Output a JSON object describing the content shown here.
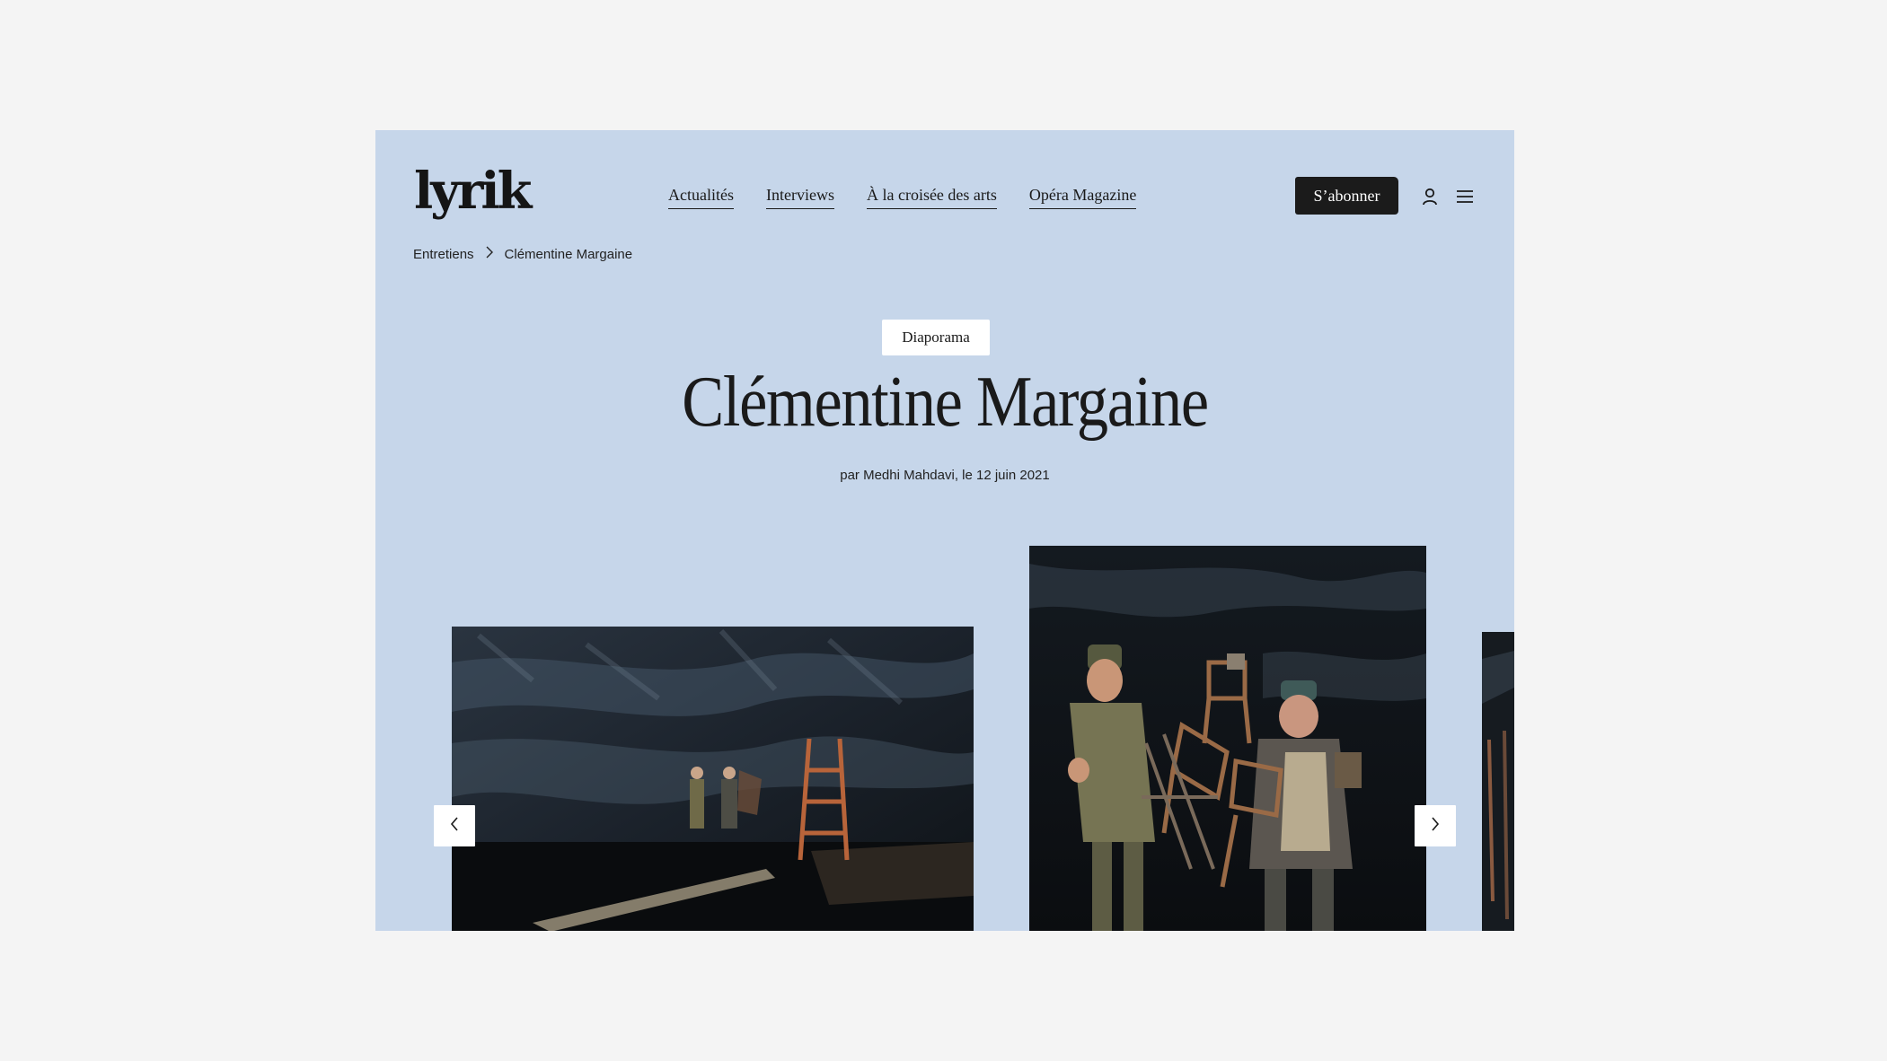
{
  "header": {
    "logo": "lyrik",
    "nav": [
      {
        "label": "Actualités"
      },
      {
        "label": "Interviews"
      },
      {
        "label": "À la croisée des arts"
      },
      {
        "label": "Opéra Magazine"
      }
    ],
    "subscribe_label": "S’abonner",
    "icons": {
      "user": "user-icon",
      "menu": "menu-icon"
    }
  },
  "breadcrumb": {
    "items": [
      "Entretiens",
      "Clémentine Margaine"
    ],
    "separator_icon": "chevron-right-icon"
  },
  "article": {
    "tag": "Diaporama",
    "title": "Clémentine Margaine",
    "byline": "par Medhi Mahdavi, le 12 juin 2021"
  },
  "carousel": {
    "prev_icon": "chevron-left-icon",
    "next_icon": "chevron-right-icon"
  },
  "colors": {
    "page_background": "#f4f4f4",
    "frame_background": "#c6d6ea",
    "ink": "#1a1a1a",
    "button_dark": "#1b1b1b"
  }
}
